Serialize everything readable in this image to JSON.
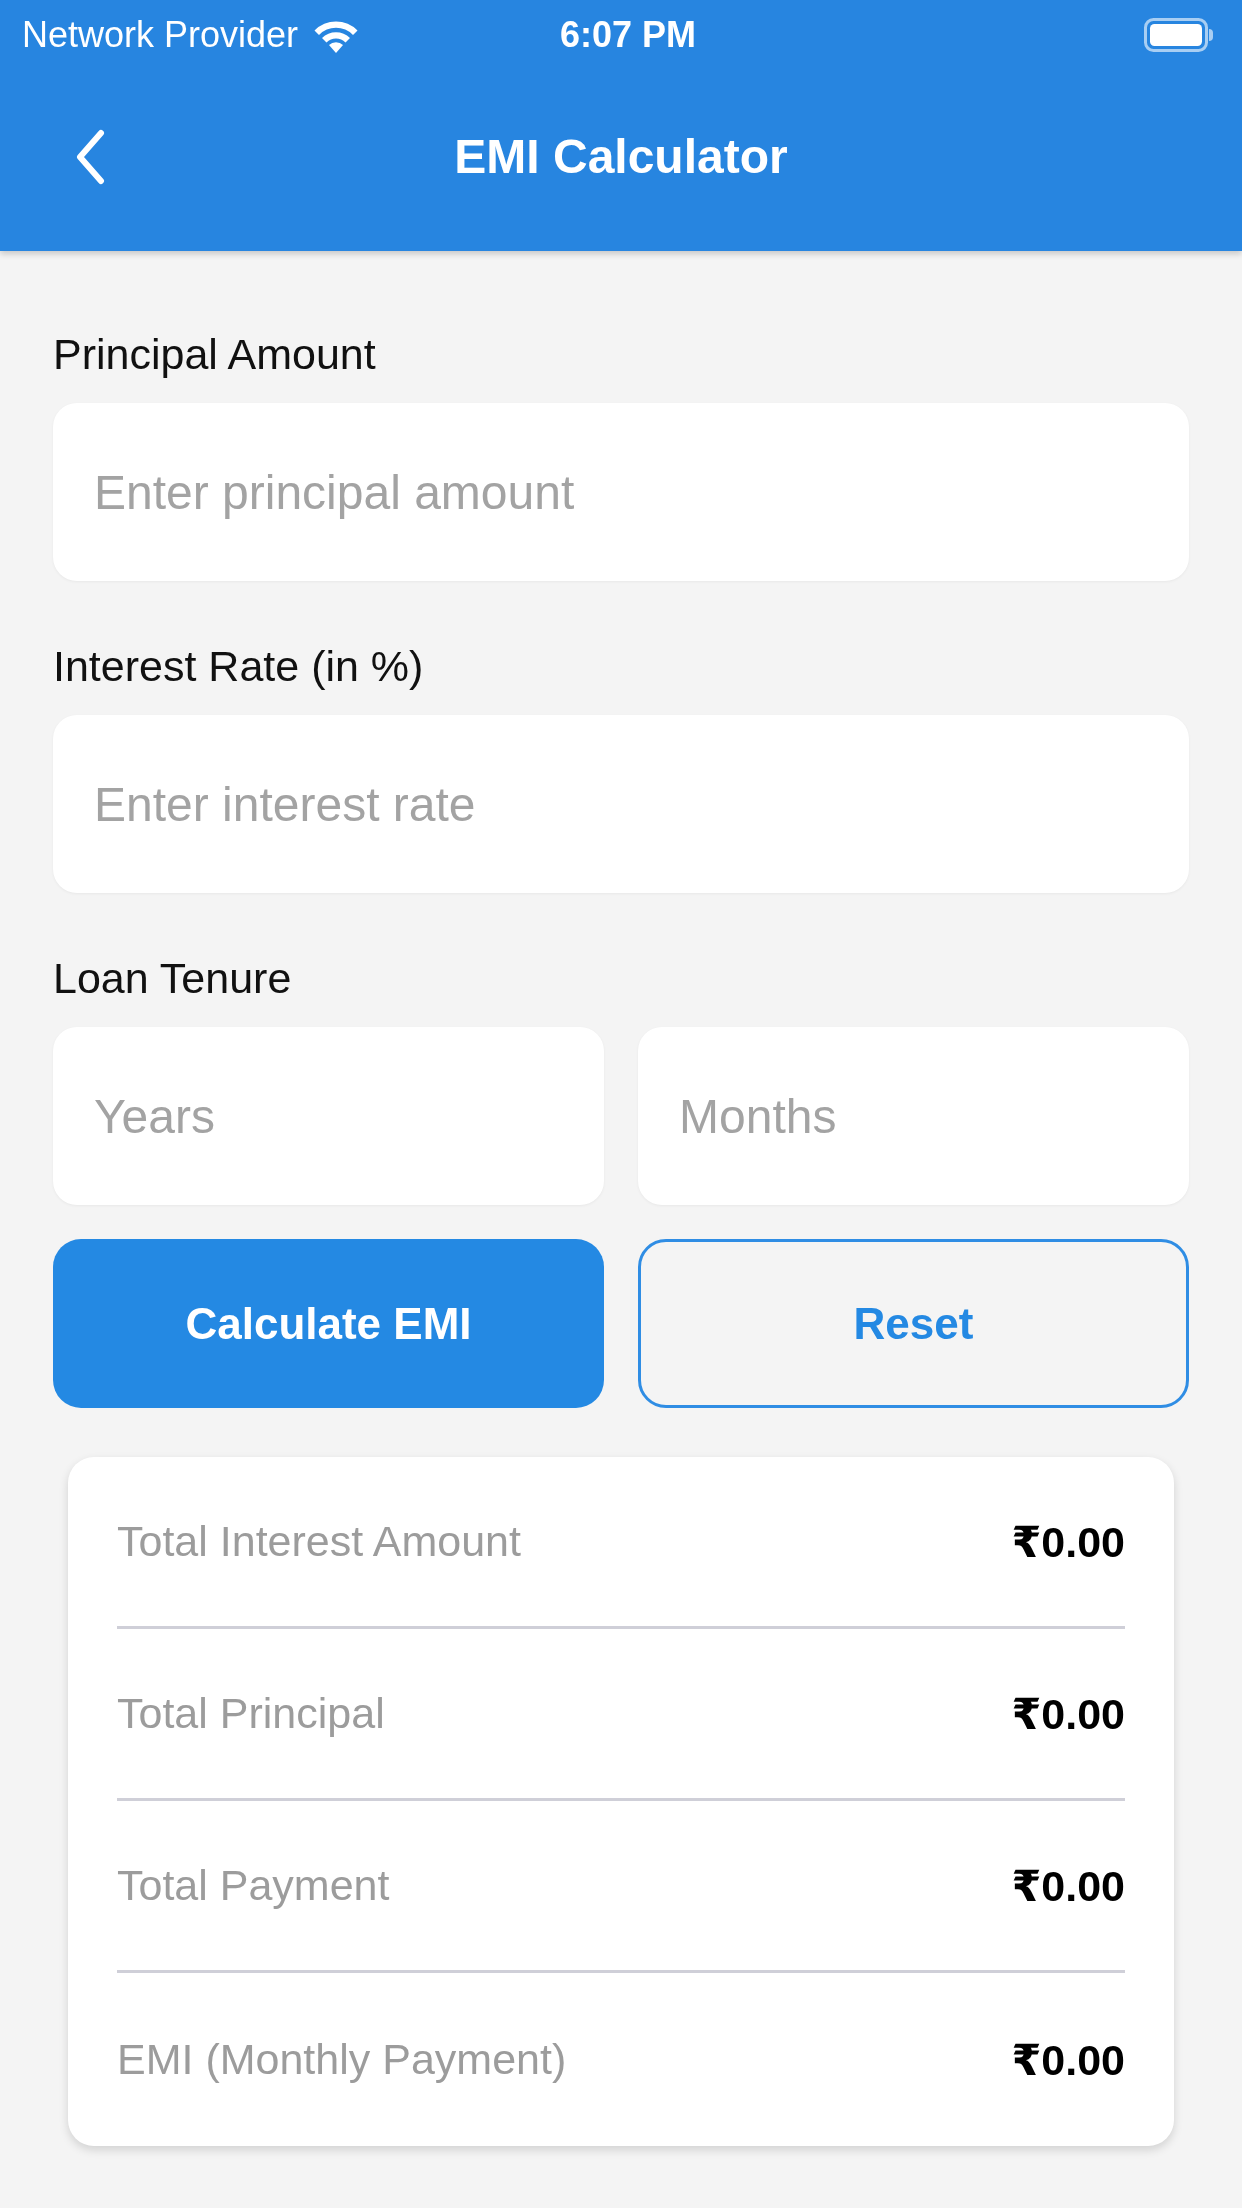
{
  "status_bar": {
    "carrier": "Network Provider",
    "time": "6:07 PM"
  },
  "nav_bar": {
    "title": "EMI Calculator"
  },
  "fields": [
    {
      "label": "Principal Amount",
      "placeholder": "Enter principal amount"
    },
    {
      "label": "Interest Rate (in %)",
      "placeholder": "Enter interest rate"
    }
  ],
  "tenure": {
    "label": "Loan Tenure",
    "fields": [
      {
        "placeholder": "Years"
      },
      {
        "placeholder": "Months"
      }
    ]
  },
  "buttons": [
    {
      "label": "Calculate EMI",
      "kind": "primary"
    },
    {
      "label": "Reset",
      "kind": "outline"
    }
  ],
  "results": [
    {
      "label": "Total Interest Amount",
      "value": "₹0.00"
    },
    {
      "label": "Total Principal",
      "value": "₹0.00"
    },
    {
      "label": "Total Payment",
      "value": "₹0.00"
    },
    {
      "label": "EMI (Monthly Payment)",
      "value": "₹0.00"
    }
  ]
}
